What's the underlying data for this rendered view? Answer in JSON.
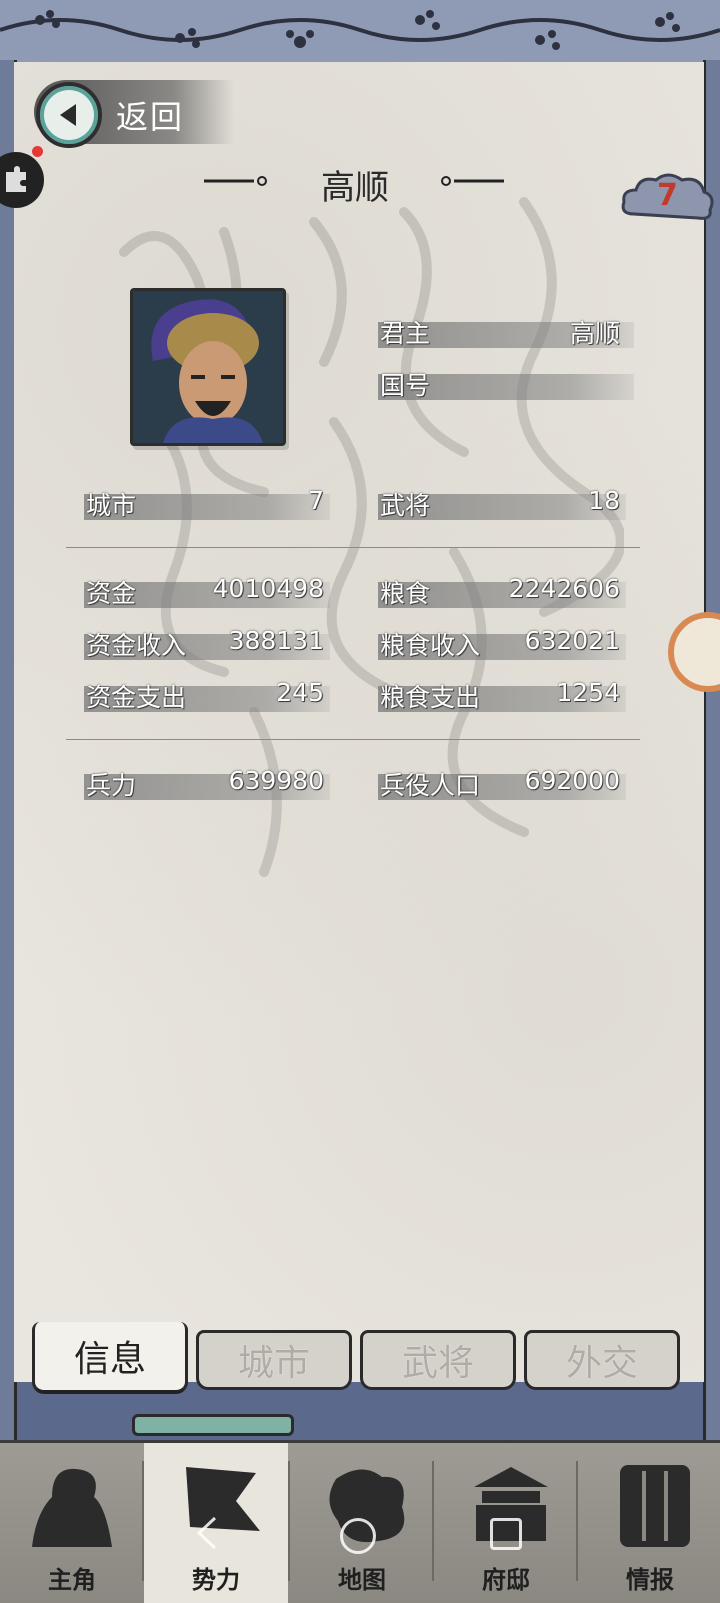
{
  "header": {
    "back_label": "返回",
    "title": "高顺",
    "badge_count": "7"
  },
  "profile": {
    "rows": [
      {
        "label": "君主",
        "value": "高顺"
      },
      {
        "label": "国号",
        "value": ""
      }
    ]
  },
  "stats_group1": [
    {
      "label": "城市",
      "value": "7"
    },
    {
      "label": "武将",
      "value": "18"
    }
  ],
  "stats_group2": [
    {
      "label": "资金",
      "value": "4010498"
    },
    {
      "label": "粮食",
      "value": "2242606"
    },
    {
      "label": "资金收入",
      "value": "388131"
    },
    {
      "label": "粮食收入",
      "value": "632021"
    },
    {
      "label": "资金支出",
      "value": "245"
    },
    {
      "label": "粮食支出",
      "value": "1254"
    }
  ],
  "stats_group3": [
    {
      "label": "兵力",
      "value": "639980"
    },
    {
      "label": "兵役人口",
      "value": "692000"
    }
  ],
  "tabs": [
    {
      "label": "信息",
      "active": true
    },
    {
      "label": "城市",
      "active": false
    },
    {
      "label": "武将",
      "active": false
    },
    {
      "label": "外交",
      "active": false
    }
  ],
  "nav": [
    {
      "label": "主角",
      "icon": "warrior-icon"
    },
    {
      "label": "势力",
      "icon": "flag-icon",
      "active": true
    },
    {
      "label": "地图",
      "icon": "map-icon"
    },
    {
      "label": "府邸",
      "icon": "mansion-icon"
    },
    {
      "label": "情报",
      "icon": "scroll-icon"
    }
  ]
}
